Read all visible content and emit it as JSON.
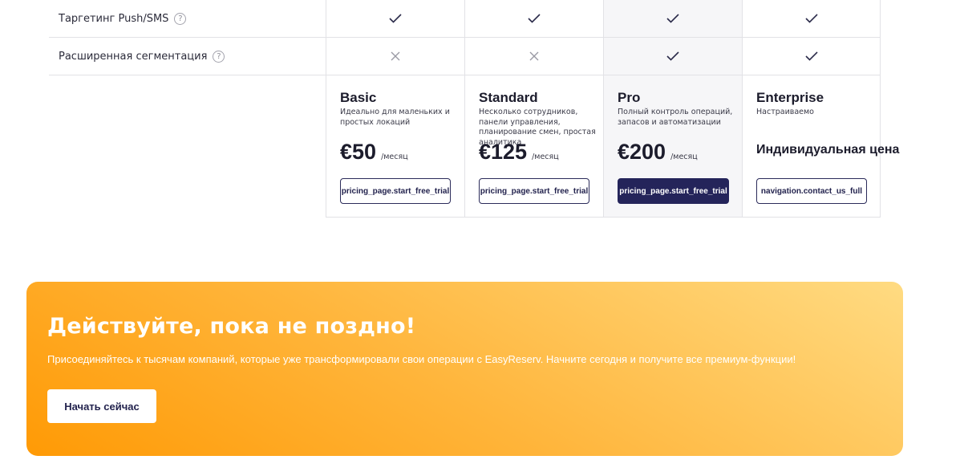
{
  "features": [
    {
      "label": "Таргетинг Push/SMS",
      "help_icon": "question-circle-icon",
      "values": [
        "check",
        "check",
        "check",
        "check"
      ]
    },
    {
      "label": "Расширенная сегментация",
      "help_icon": "question-circle-icon",
      "values": [
        "cross",
        "cross",
        "check",
        "check"
      ]
    }
  ],
  "help_glyph": "?",
  "plans": [
    {
      "name": "Basic",
      "description": "Идеально для маленьких и простых локаций",
      "price": "€50",
      "period": "/месяц",
      "button_label": "pricing_page.start_free_trial",
      "highlighted": false
    },
    {
      "name": "Standard",
      "description": "Несколько сотрудников, панели управления, планирование смен, простая аналитика",
      "price": "€125",
      "period": "/месяц",
      "button_label": "pricing_page.start_free_trial",
      "highlighted": false
    },
    {
      "name": "Pro",
      "description": "Полный контроль операций, запасов и автоматизации",
      "price": "€200",
      "period": "/месяц",
      "button_label": "pricing_page.start_free_trial",
      "highlighted": true
    },
    {
      "name": "Enterprise",
      "description": "Настраиваемо",
      "custom_price": "Индивидуальная цена",
      "button_label": "navigation.contact_us_full",
      "highlighted": false
    }
  ],
  "cta": {
    "title": "Действуйте, пока не поздно!",
    "text": "Присоединяйтесь к тысячам компаний, которые уже трансформировали свои операции с EasyReserv. Начните сегодня и получите все премиум-функции!",
    "button_label": "Начать сейчас"
  },
  "colors": {
    "accent_dark": "#24245a",
    "cta_gradient_start": "#ff9a05",
    "cta_gradient_end": "#ffdb82"
  }
}
